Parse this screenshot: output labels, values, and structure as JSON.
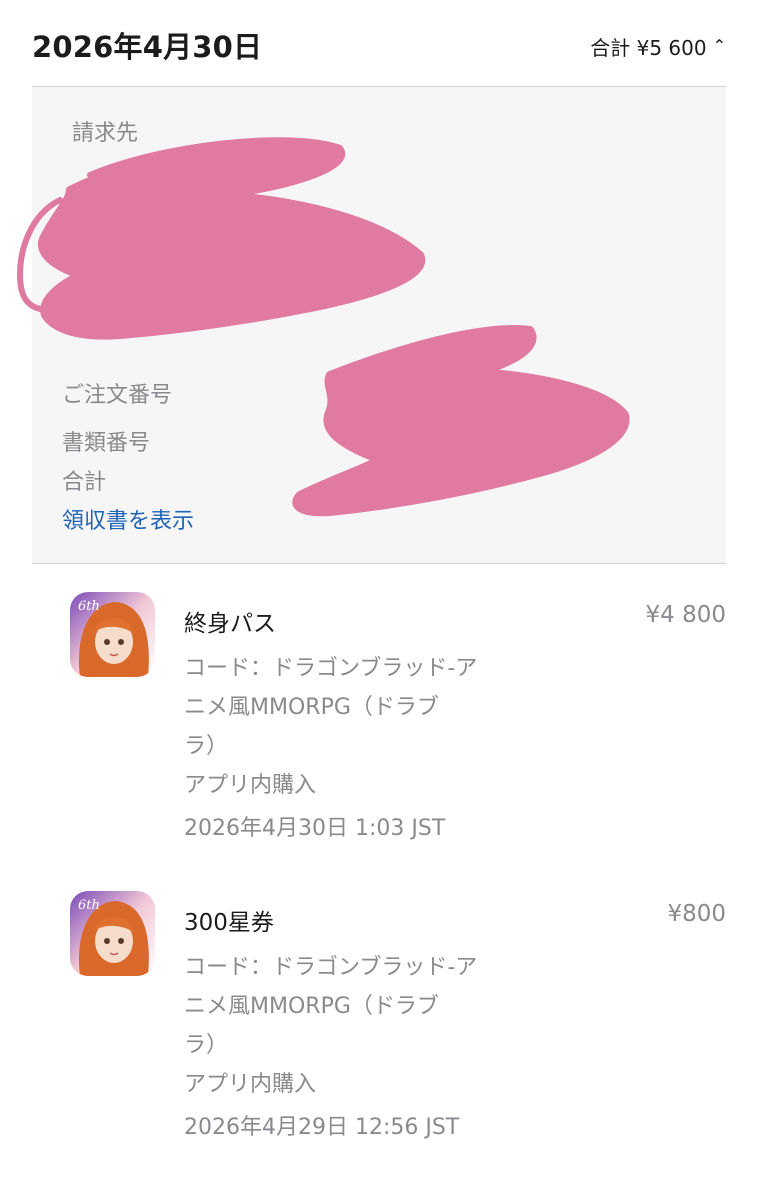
{
  "header": {
    "date": "2026年4月30日",
    "total_summary": "合計 ¥5 600"
  },
  "billing": {
    "billed_to_label": "請求先",
    "order_number_label": "ご注文番号",
    "document_number_label": "書類番号",
    "total_label": "合計",
    "view_receipt_link": "領収書を表示",
    "redaction_color": "#e07aa0"
  },
  "items": [
    {
      "title": "終身パス",
      "price": "¥4 800",
      "code_line1": "コード：ドラゴンブラッド-ア",
      "code_line2": "ニメ風MMORPG（ドラブ",
      "code_line3": "ラ）",
      "type": "アプリ内購入",
      "timestamp": "2026年4月30日 1:03 JST",
      "icon": "app-icon-anime-girl"
    },
    {
      "title": "300星券",
      "price": "¥800",
      "code_line1": "コード：ドラゴンブラッド-ア",
      "code_line2": "ニメ風MMORPG（ドラブ",
      "code_line3": "ラ）",
      "type": "アプリ内購入",
      "timestamp": "2026年4月29日 12:56 JST",
      "icon": "app-icon-anime-girl"
    }
  ],
  "icons": {
    "chevron": "chevron-up-icon"
  }
}
